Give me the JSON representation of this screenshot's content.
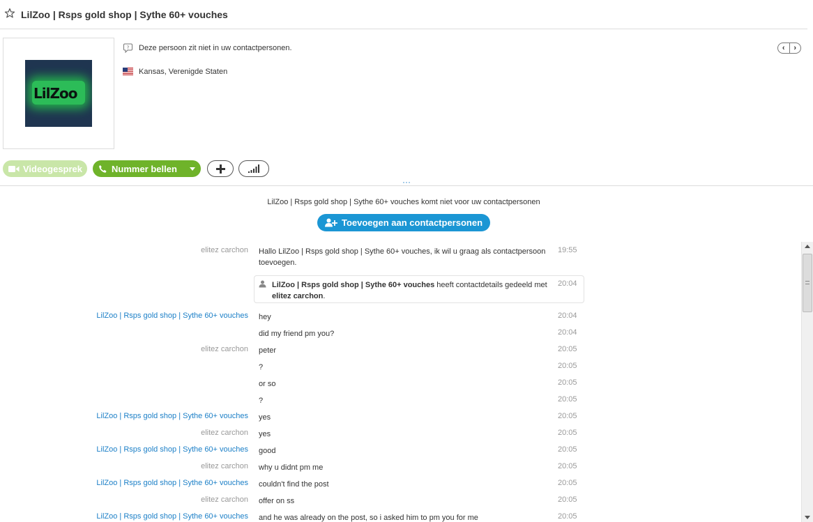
{
  "header": {
    "title": "LilZoo | Rsps gold shop | Sythe 60+ vouches"
  },
  "profile": {
    "avatar_text": "LilZoo",
    "status_note": "Deze persoon zit niet in uw contactpersonen.",
    "location": "Kansas, Verenigde Staten"
  },
  "actions": {
    "video_label": "Videogesprek",
    "call_label": "Nummer bellen"
  },
  "chat_header": {
    "notice": "LilZoo | Rsps gold shop | Sythe 60+ vouches komt niet voor uw contactpersonen",
    "add_label": "Toevoegen aan contactpersonen"
  },
  "system_message": {
    "name": "LilZoo | Rsps gold shop | Sythe 60+ vouches",
    "text1": " heeft contactdetails gedeeld met ",
    "target": "elitez carchon",
    "end": ".",
    "time": "20:04"
  },
  "messages": [
    {
      "sender": "elitez carchon",
      "text": "Hallo LilZoo | Rsps gold shop | Sythe 60+ vouches, ik wil u graag als contactpersoon toevoegen.",
      "time": "19:55",
      "from_me": true
    },
    {
      "sender": "LilZoo | Rsps gold shop | Sythe 60+ vouches",
      "text": "hey",
      "time": "20:04",
      "from_me": false
    },
    {
      "sender": "",
      "text": "did my friend pm you?",
      "time": "20:04",
      "from_me": false
    },
    {
      "sender": "elitez carchon",
      "text": "peter",
      "time": "20:05",
      "from_me": true
    },
    {
      "sender": "",
      "text": "?",
      "time": "20:05",
      "from_me": true
    },
    {
      "sender": "",
      "text": "or so",
      "time": "20:05",
      "from_me": true
    },
    {
      "sender": "",
      "text": "?",
      "time": "20:05",
      "from_me": true
    },
    {
      "sender": "LilZoo | Rsps gold shop | Sythe 60+ vouches",
      "text": "yes",
      "time": "20:05",
      "from_me": false
    },
    {
      "sender": "elitez carchon",
      "text": "yes",
      "time": "20:05",
      "from_me": true
    },
    {
      "sender": "LilZoo | Rsps gold shop | Sythe 60+ vouches",
      "text": "good",
      "time": "20:05",
      "from_me": false
    },
    {
      "sender": "elitez carchon",
      "text": "why u didnt pm me",
      "time": "20:05",
      "from_me": true
    },
    {
      "sender": "LilZoo | Rsps gold shop | Sythe 60+ vouches",
      "text": "couldn't find the post",
      "time": "20:05",
      "from_me": false
    },
    {
      "sender": "elitez carchon",
      "text": "offer on ss",
      "time": "20:05",
      "from_me": true
    },
    {
      "sender": "LilZoo | Rsps gold shop | Sythe 60+ vouches",
      "text": "and he was already on the post, so i asked him to pm you for me",
      "time": "20:05",
      "from_me": false
    }
  ]
}
